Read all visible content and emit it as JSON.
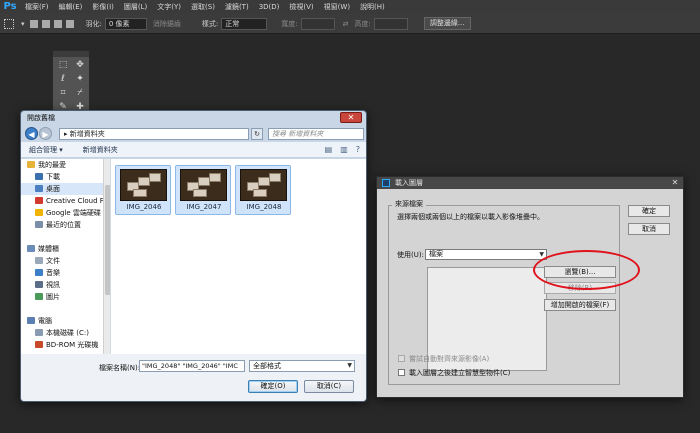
{
  "photoshop": {
    "logo": "Ps",
    "menu": [
      "檔案(F)",
      "編輯(E)",
      "影像(I)",
      "圖層(L)",
      "文字(Y)",
      "選取(S)",
      "濾鏡(T)",
      "3D(D)",
      "檢視(V)",
      "視窗(W)",
      "說明(H)"
    ],
    "options": {
      "feather_label": "羽化:",
      "feather_value": "0 像素",
      "antialias_label": "消除鋸齒",
      "style_label": "樣式:",
      "style_value": "正常",
      "width_label": "寬度:",
      "height_label": "高度:",
      "refine_button": "調整邊緣..."
    }
  },
  "open_dialog": {
    "title": "開啟舊檔",
    "address": "新增資料夾",
    "search_placeholder": "搜尋 新增資料夾",
    "toolbar": {
      "organize": "組合管理 ▾",
      "new_folder": "新增資料夾"
    },
    "nav": [
      {
        "label": "我的最愛",
        "group": true,
        "color": "#e8b339"
      },
      {
        "label": "下載",
        "group": false,
        "color": "#3a6fb0"
      },
      {
        "label": "桌面",
        "group": false,
        "color": "#4b7fc0",
        "selected": true
      },
      {
        "label": "Creative Cloud F",
        "group": false,
        "color": "#d23a2e"
      },
      {
        "label": "Google 雲端硬碟",
        "group": false,
        "color": "#f0b400"
      },
      {
        "label": "最近的位置",
        "group": false,
        "color": "#7a8ea8"
      },
      {
        "label": "",
        "group": false,
        "color": ""
      },
      {
        "label": "媒體櫃",
        "group": true,
        "color": "#6a8cb8"
      },
      {
        "label": "文件",
        "group": false,
        "color": "#9aa8b8"
      },
      {
        "label": "音樂",
        "group": false,
        "color": "#3a7fc8"
      },
      {
        "label": "視訊",
        "group": false,
        "color": "#5a6e88"
      },
      {
        "label": "圖片",
        "group": false,
        "color": "#4a9a5a"
      },
      {
        "label": "",
        "group": false,
        "color": ""
      },
      {
        "label": "電腦",
        "group": true,
        "color": "#5a7fb0"
      },
      {
        "label": "本機磁碟 (C:)",
        "group": false,
        "color": "#8a9ab0"
      },
      {
        "label": "BD-ROM 光碟機",
        "group": false,
        "color": "#c84a2a"
      }
    ],
    "files": [
      "IMG_2046",
      "IMG_2047",
      "IMG_2048"
    ],
    "filename_label": "檔案名稱(N):",
    "filename_value": "\"IMG_2048\" \"IMG_2046\" \"IMC",
    "filter_value": "全部格式",
    "open_button": "確定(O)",
    "cancel_button": "取消(C)"
  },
  "load_dialog": {
    "title": "載入圖層",
    "group_title": "來源檔案",
    "instruction": "選擇兩個或兩個以上的檔案以載入影像堆疊中。",
    "use_label": "使用(U):",
    "use_value": "檔案",
    "browse_button": "瀏覽(B)...",
    "remove_button": "移除(R)",
    "add_open_button": "增加開啟的檔案(F)",
    "ok_button": "確定",
    "cancel_button": "取消",
    "auto_align_label": "嘗試自動對齊來源影像(A)",
    "smart_object_label": "載入圖層之後建立智慧型物件(C)"
  }
}
